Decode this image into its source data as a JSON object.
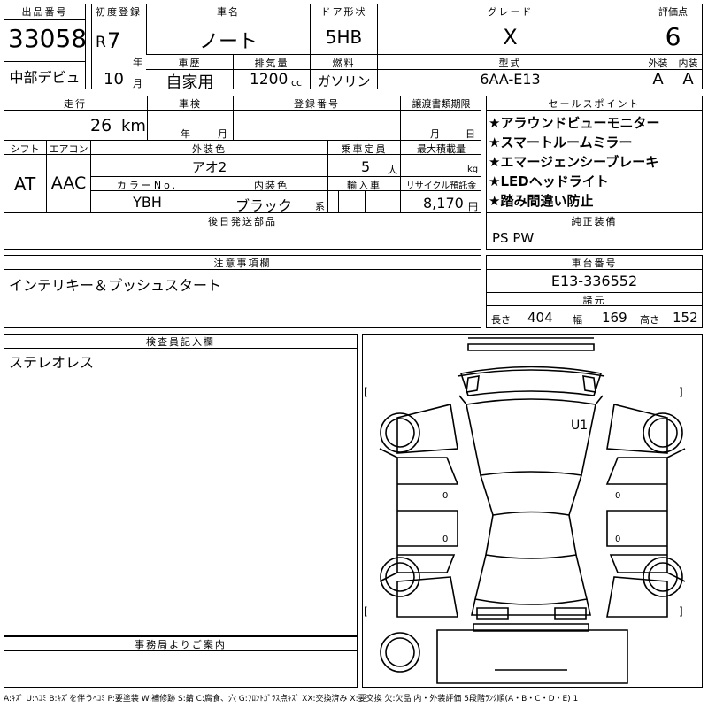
{
  "lot": {
    "label": "出品番号",
    "value": "33058",
    "venue": "中部デビュ"
  },
  "first_reg": {
    "label": "初度登録",
    "era": "R",
    "year_num": "7",
    "year_unit": "年",
    "month_num": "10",
    "month_unit": "月"
  },
  "car_name": {
    "label": "車名",
    "value": "ノート"
  },
  "door": {
    "label": "ドア形状",
    "value": "5HB"
  },
  "grade": {
    "label": "グレード",
    "value": "X"
  },
  "score": {
    "label": "評価点",
    "value": "6"
  },
  "history": {
    "label": "車歴",
    "value": "自家用"
  },
  "displacement": {
    "label": "排気量",
    "value": "1200",
    "unit": "cc"
  },
  "fuel": {
    "label": "燃料",
    "value": "ガソリン"
  },
  "model": {
    "label": "型式",
    "value": "6AA-E13"
  },
  "exterior_score": {
    "label": "外装",
    "value": "A"
  },
  "interior_score": {
    "label": "内装",
    "value": "A"
  },
  "mileage": {
    "label": "走行",
    "value": "26",
    "unit": "km"
  },
  "inspection": {
    "label": "車検",
    "year_unit": "年",
    "month_unit": "月"
  },
  "reg_number": {
    "label": "登録番号"
  },
  "transfer_doc": {
    "label": "譲渡書類期限",
    "month_unit": "月",
    "day_unit": "日"
  },
  "shift": {
    "label": "シフト",
    "value": "AT"
  },
  "aircon": {
    "label": "エアコン",
    "value": "AAC"
  },
  "ext_color": {
    "label": "外装色",
    "value": "アオ2"
  },
  "capacity": {
    "label": "乗車定員",
    "value": "5",
    "unit": "人"
  },
  "max_load": {
    "label": "最大積載量",
    "unit": "kg"
  },
  "color_no": {
    "label": "カラーNo.",
    "value": "YBH"
  },
  "int_color": {
    "label": "内装色",
    "value": "ブラック",
    "suffix": "系"
  },
  "import": {
    "label": "輸入車"
  },
  "recycle": {
    "label": "リサイクル預託金",
    "value": "8,170",
    "unit": "円"
  },
  "later_parts": {
    "label": "後日発送部品"
  },
  "sales_points": {
    "label": "セールスポイント",
    "items": [
      "★アラウンドビューモニター",
      "★スマートルームミラー",
      "★エマージェンシーブレーキ",
      "★LEDヘッドライト",
      "★踏み間違い防止"
    ]
  },
  "equipment": {
    "label": "純正装備",
    "value": "PS PW"
  },
  "notes": {
    "label": "注意事項欄",
    "value": "インテリキー＆プッシュスタート"
  },
  "chassis": {
    "label": "車台番号",
    "value": "E13-336552"
  },
  "dims": {
    "label": "諸元",
    "length_label": "長さ",
    "length": "404",
    "width_label": "幅",
    "width": "169",
    "height_label": "高さ",
    "height": "152"
  },
  "inspector": {
    "label": "検査員記入欄",
    "value": "ステレオレス"
  },
  "office": {
    "label": "事務局よりご案内"
  },
  "diagram": {
    "mark_u1": "U1",
    "zeros": [
      "0",
      "0",
      "0",
      "0"
    ],
    "bracket_open": "[",
    "bracket_close": "]"
  },
  "legend": "A:ｷｽﾞ U:ﾍｺﾐ B:ｷｽﾞを伴うﾍｺﾐ P:要塗装 W:補修跡 S:錆 C:腐食、穴 G:ﾌﾛﾝﾄｶﾞﾗｽ点ｷｽﾞ XX:交換済み X:要交換 欠:欠品 内・外装評価 5段階ﾗﾝｸ順(A・B・C・D・E) 1"
}
